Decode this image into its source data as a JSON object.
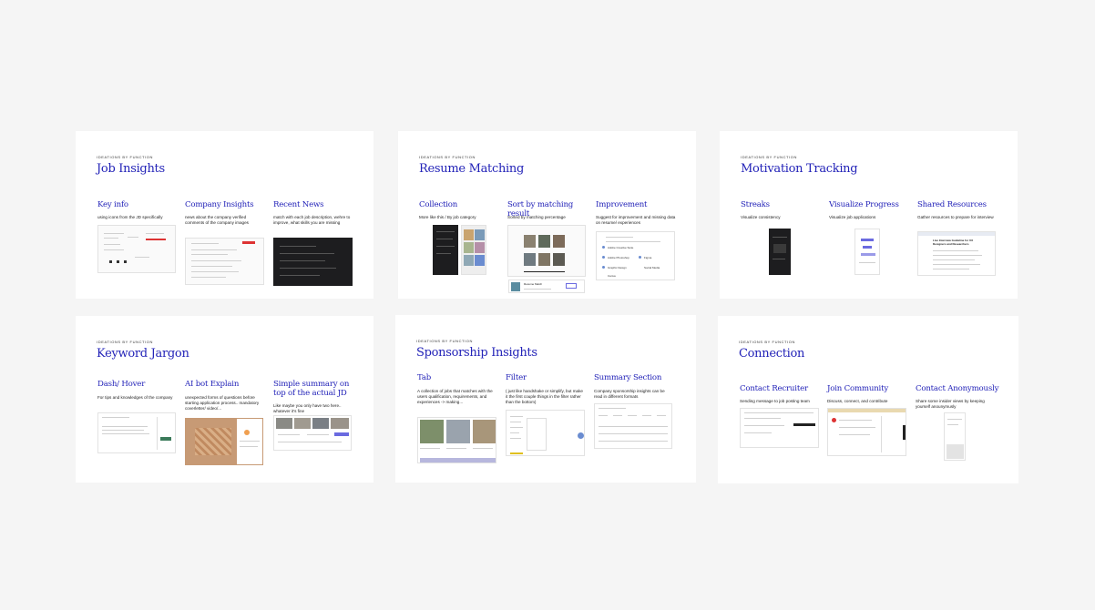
{
  "cards": [
    {
      "eyebrow": "IDEATIONS BY FUNCTION",
      "title": "Job Insights",
      "features": [
        {
          "title": "Key info",
          "desc": "using icons from the JD specifically"
        },
        {
          "title": "Company Insights",
          "desc": "news about the company verified comments of the company images"
        },
        {
          "title": "Recent News",
          "desc": "match with each job description, wehre to improve, what skills you are missing"
        }
      ]
    },
    {
      "eyebrow": "IDEATIONS BY FUNCTION",
      "title": "Resume Matching",
      "features": [
        {
          "title": "Collection",
          "desc": "More like this / By job category"
        },
        {
          "title": "Sort by matching result",
          "desc": "Sorted by matching percentage"
        },
        {
          "title": "Improvement",
          "desc": "Suggest for improvement and missing data on resume/ experiences"
        }
      ]
    },
    {
      "eyebrow": "IDEATIONS BY FUNCTION",
      "title": "Motivation Tracking",
      "features": [
        {
          "title": "Streaks",
          "desc": "Visualize consistency"
        },
        {
          "title": "Visualize Progress",
          "desc": "Visualize job applications"
        },
        {
          "title": "Shared Resources",
          "desc": "Gather resources to prepare for interview"
        }
      ]
    },
    {
      "eyebrow": "IDEATIONS BY FUNCTION",
      "title": "Keyword Jargon",
      "features": [
        {
          "title": "Dash/ Hover",
          "desc": "For tips and knowledges of the company"
        },
        {
          "title": "AI bot Explain",
          "desc": "unexpected forms of questions before starting application process.. mandatory coverletter/ video/..."
        },
        {
          "title": "Simple summary on top of the actual JD",
          "desc": "Like maybe you only have two here.. whatever it's fine"
        }
      ]
    },
    {
      "eyebrow": "IDEATIONS BY FUNCTION",
      "title": "Sponsorship Insights",
      "features": [
        {
          "title": "Tab",
          "desc": "A collection of jobs that matches with the users qualification, requirements, and experiences -> making..."
        },
        {
          "title": "Filter",
          "desc": "( just like handshake or simplify, but make it the first couple things in the filter rather than the bottom)"
        },
        {
          "title": "Summary Section",
          "desc": "Company sponsorship insights can be read in different formats"
        }
      ]
    },
    {
      "eyebrow": "IDEATIONS BY FUNCTION",
      "title": "Connection",
      "features": [
        {
          "title": "Contact Recruiter",
          "desc": "Sending message to job posting team"
        },
        {
          "title": "Join Community",
          "desc": "Discuss, connect, and contribute"
        },
        {
          "title": "Contact Anonymously",
          "desc": "Share some insider views by keeping yourself anounymusly"
        }
      ]
    }
  ],
  "thumb_labels": {
    "improve_btn_1": "Adobe Creative Suite",
    "improve_btn_2": "Adobe Photoshop",
    "improve_btn_3": "Figma",
    "improve_btn_4": "Graphic Design",
    "improve_btn_5": "Social Media",
    "improve_btn_6": "Canva",
    "shared_res_title": "Live Interview Guideline for UX Designers and Researchers",
    "resume_match_label": "Resume Match"
  },
  "colors": {
    "background": "#f5f5f5",
    "card": "#ffffff",
    "accent": "#2323b8"
  }
}
